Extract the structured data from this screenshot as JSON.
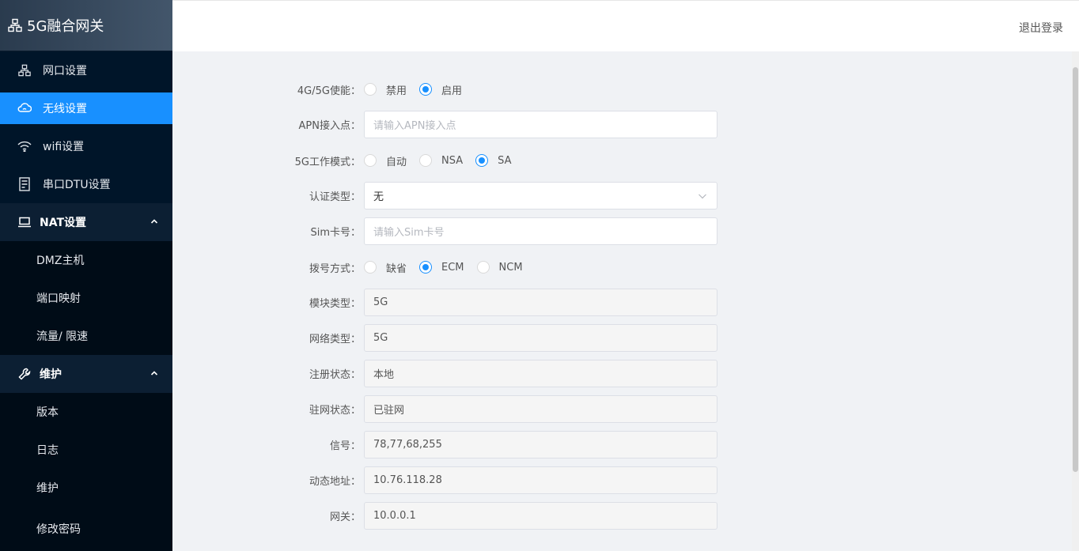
{
  "app": {
    "title": "5G融合网关",
    "logo_icon": "network-icon"
  },
  "header": {
    "logout_label": "退出登录"
  },
  "sidebar": {
    "items": [
      {
        "label": "网口设置",
        "icon": "network-icon"
      },
      {
        "label": "无线设置",
        "icon": "wireless-cloud-icon",
        "active": true
      },
      {
        "label": "wifi设置",
        "icon": "wifi-icon"
      },
      {
        "label": "串口DTU设置",
        "icon": "server-icon"
      }
    ],
    "nat": {
      "label": "NAT设置",
      "icon": "laptop-icon",
      "children": [
        "DMZ主机",
        "端口映射",
        "流量/ 限速"
      ]
    },
    "maintenance": {
      "label": "维护",
      "icon": "wrench-icon",
      "children": [
        "版本",
        "日志",
        "维护",
        "修改密码"
      ]
    }
  },
  "form": {
    "enable": {
      "label": "4G/5G使能",
      "options": [
        "禁用",
        "启用"
      ],
      "selected": "启用"
    },
    "apn": {
      "label": "APN接入点",
      "value": "",
      "placeholder": "请输入APN接入点"
    },
    "mode": {
      "label": "5G工作模式",
      "options": [
        "自动",
        "NSA",
        "SA"
      ],
      "selected": "SA"
    },
    "auth": {
      "label": "认证类型",
      "value": "无"
    },
    "sim": {
      "label": "Sim卡号",
      "value": "",
      "placeholder": "请输入Sim卡号"
    },
    "dial": {
      "label": "拨号方式",
      "options": [
        "缺省",
        "ECM",
        "NCM"
      ],
      "selected": "ECM"
    },
    "module_type": {
      "label": "模块类型",
      "value": "5G"
    },
    "network_type": {
      "label": "网络类型",
      "value": "5G"
    },
    "reg_status": {
      "label": "注册状态",
      "value": "本地"
    },
    "camp_status": {
      "label": "驻网状态",
      "value": "已驻网"
    },
    "signal": {
      "label": "信号",
      "value": "78,77,68,255"
    },
    "dyn_addr": {
      "label": "动态地址",
      "value": "10.76.118.28"
    },
    "gateway": {
      "label": "网关",
      "value": "10.0.0.1"
    }
  },
  "colors": {
    "accent": "#1890ff",
    "sidebar_bg": "#001529",
    "submenu_bg": "#000c17"
  }
}
